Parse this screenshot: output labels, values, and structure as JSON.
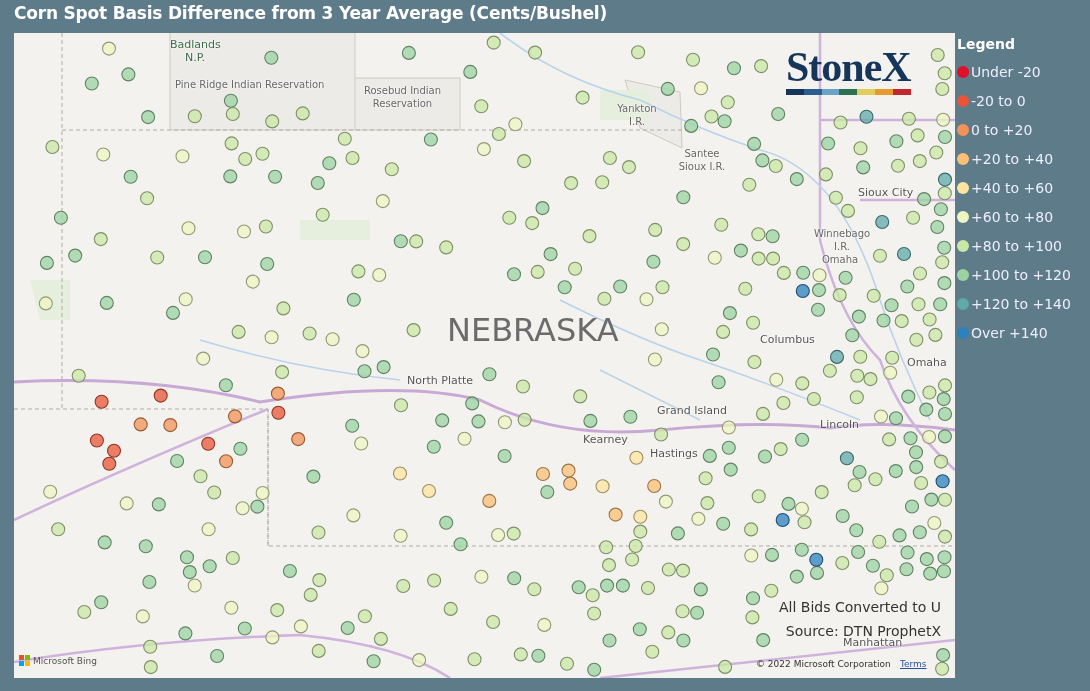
{
  "title": "Corn Spot Basis Difference from 3 Year Average (Cents/Bushel)",
  "map": {
    "labels": [
      {
        "text": "Badlands N.P.",
        "kind": "park"
      },
      {
        "text": "Pine Ridge Indian Reservation",
        "kind": "area"
      },
      {
        "text": "Rosebud Indian Reservation",
        "kind": "area"
      },
      {
        "text": "Yankton I.R.",
        "kind": "area"
      },
      {
        "text": "Santee Sioux I.R.",
        "kind": "area"
      },
      {
        "text": "Sioux City",
        "kind": "city"
      },
      {
        "text": "Winnebago I.R.",
        "kind": "area"
      },
      {
        "text": "Omaha",
        "kind": "area"
      },
      {
        "text": "NEBRASKA",
        "kind": "state"
      },
      {
        "text": "North Platte",
        "kind": "city"
      },
      {
        "text": "Columbus",
        "kind": "city"
      },
      {
        "text": "Omaha",
        "kind": "city"
      },
      {
        "text": "Grand Island",
        "kind": "city"
      },
      {
        "text": "Kearney",
        "kind": "city"
      },
      {
        "text": "Hastings",
        "kind": "city"
      },
      {
        "text": "Lincoln",
        "kind": "city"
      },
      {
        "text": "Manhattan",
        "kind": "city"
      }
    ],
    "logo": "StoneX",
    "notes": [
      "All Bids Converted to U",
      "Source: DTN ProphetX"
    ],
    "attribution": {
      "brand": "Microsoft Bing",
      "copyright": "© 2022 Microsoft Corporation",
      "link": "Terms"
    }
  },
  "legend": {
    "title": "Legend",
    "items": [
      {
        "label": "Under -20",
        "color": "#e0102a"
      },
      {
        "label": "-20 to 0",
        "color": "#e8553a"
      },
      {
        "label": "0 to +20",
        "color": "#f39256"
      },
      {
        "label": "+20 to +40",
        "color": "#fbbf76"
      },
      {
        "label": "+40 to +60",
        "color": "#fde5a0"
      },
      {
        "label": "+60 to +80",
        "color": "#eef5c0"
      },
      {
        "label": "+80 to +100",
        "color": "#c9e8a6"
      },
      {
        "label": "+100 to +120",
        "color": "#9bd3a0"
      },
      {
        "label": "+120 to +140",
        "color": "#5fa9aa"
      },
      {
        "label": "Over +140",
        "color": "#2c80bd"
      }
    ]
  }
}
